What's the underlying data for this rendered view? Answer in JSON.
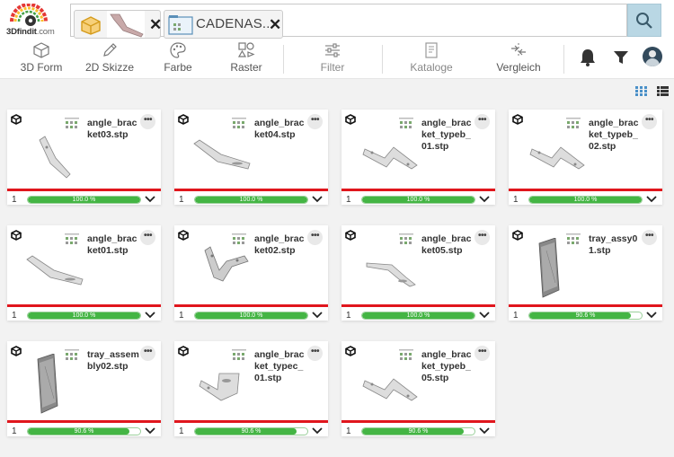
{
  "logo": {
    "brand": "3D",
    "name": "findit",
    "tld": ".com"
  },
  "search": {
    "chips": [
      {
        "label": "",
        "icon": "3d-box-icon",
        "thumb": "angle-bracket-thumbnail"
      },
      {
        "label": "CADENAS...",
        "icon": "catalog-folder-icon"
      }
    ],
    "button_icon": "search-icon"
  },
  "toolbar": {
    "items": [
      {
        "id": "3d-form",
        "label": "3D Form",
        "icon": "cube-outline-icon"
      },
      {
        "id": "2d-skizze",
        "label": "2D Skizze",
        "icon": "pencil-icon"
      },
      {
        "id": "farbe",
        "label": "Farbe",
        "icon": "palette-icon"
      },
      {
        "id": "raster",
        "label": "Raster",
        "icon": "raster-shapes-icon"
      },
      {
        "id": "filter",
        "label": "Filter",
        "icon": "sliders-icon"
      },
      {
        "id": "kataloge",
        "label": "Kataloge",
        "icon": "catalog-book-icon"
      },
      {
        "id": "vergleich",
        "label": "Vergleich",
        "icon": "compare-arrows-icon"
      }
    ],
    "right_icons": [
      "bell-icon",
      "funnel-icon",
      "user-avatar"
    ]
  },
  "view_modes": [
    "grid-view-icon",
    "list-view-icon"
  ],
  "cards": [
    {
      "name": "angle_bracket03.stp",
      "count": "1",
      "similarity": "100.0 %",
      "level": 100,
      "shape": "bracket-a"
    },
    {
      "name": "angle_bracket04.stp",
      "count": "1",
      "similarity": "100.0 %",
      "level": 100,
      "shape": "bracket-b"
    },
    {
      "name": "angle_bracket_typeb_01.stp",
      "count": "1",
      "similarity": "100.0 %",
      "level": 100,
      "shape": "bracket-c"
    },
    {
      "name": "angle_bracket_typeb_02.stp",
      "count": "1",
      "similarity": "100.0 %",
      "level": 100,
      "shape": "bracket-c"
    },
    {
      "name": "angle_bracket01.stp",
      "count": "1",
      "similarity": "100.0 %",
      "level": 100,
      "shape": "bracket-b"
    },
    {
      "name": "angle_bracket02.stp",
      "count": "1",
      "similarity": "100.0 %",
      "level": 100,
      "shape": "bracket-d"
    },
    {
      "name": "angle_bracket05.stp",
      "count": "1",
      "similarity": "100.0 %",
      "level": 100,
      "shape": "bracket-e"
    },
    {
      "name": "tray_assy01.stp",
      "count": "1",
      "similarity": "90.6 %",
      "level": 90.6,
      "shape": "tray"
    },
    {
      "name": "tray_assembly02.stp",
      "count": "1",
      "similarity": "90.6 %",
      "level": 90.6,
      "shape": "tray"
    },
    {
      "name": "angle_bracket_typec_01.stp",
      "count": "1",
      "similarity": "90.6 %",
      "level": 90.6,
      "shape": "bracket-f"
    },
    {
      "name": "angle_bracket_typeb_05.stp",
      "count": "1",
      "similarity": "90.6 %",
      "level": 90.6,
      "shape": "bracket-c"
    }
  ],
  "colors": {
    "accent": "#e0161d",
    "progress": "#44b544",
    "search_button": "#b9d7e4"
  }
}
